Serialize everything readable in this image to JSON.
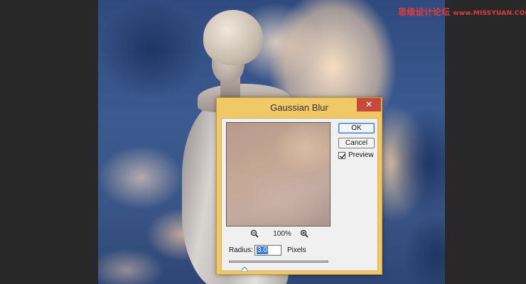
{
  "watermark": {
    "text": "思缘设计论坛",
    "url": "www.MISSYUAN.COM"
  },
  "dialog": {
    "title": "Gaussian Blur",
    "close_label": "✕",
    "ok_label": "OK",
    "cancel_label": "Cancel",
    "preview_label": "Preview",
    "preview_checked": true,
    "zoom_label": "100%",
    "radius_label": "Radius:",
    "radius_value": "3.0",
    "units_label": "Pixels"
  },
  "colors": {
    "title_bar": "#f0c866",
    "close_button": "#c7493b",
    "selection": "#3a78d6",
    "watermark": "#e33b3b"
  },
  "icons": {
    "zoom_out": "zoom-out-icon",
    "zoom_in": "zoom-in-icon",
    "checkmark": "checkmark-icon",
    "slider": "slider-thumb-icon"
  }
}
